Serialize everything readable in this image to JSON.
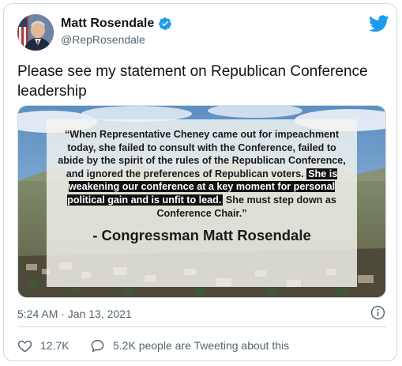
{
  "author": {
    "name": "Matt Rosendale",
    "handle": "@RepRosendale"
  },
  "tweet": {
    "text": "Please see my statement on Republican Conference leadership",
    "timestamp": "5:24 AM · Jan 13, 2021"
  },
  "media": {
    "quote_part1": "“When Representative Cheney came out for impeachment today, she failed to consult with the Conference, failed to abide by the spirit of the rules of the Republican Conference, and ignored the preferences of Republican voters.",
    "quote_highlight": "She is weakening our conference at a key moment for personal political gain and is unfit to lead.",
    "quote_part2": "She must step down as Conference Chair.”",
    "attribution": "- Congressman Matt Rosendale"
  },
  "actions": {
    "like_count": "12.7K",
    "reply_text": "5.2K people are Tweeting about this"
  },
  "colors": {
    "twitter_blue": "#1d9bf0",
    "secondary_text": "#536471",
    "border": "#cfd9de"
  },
  "icons": {
    "verified": "verified-badge-icon",
    "logo": "twitter-bird-icon",
    "info": "info-icon",
    "like": "heart-icon",
    "reply": "speech-bubble-icon"
  }
}
